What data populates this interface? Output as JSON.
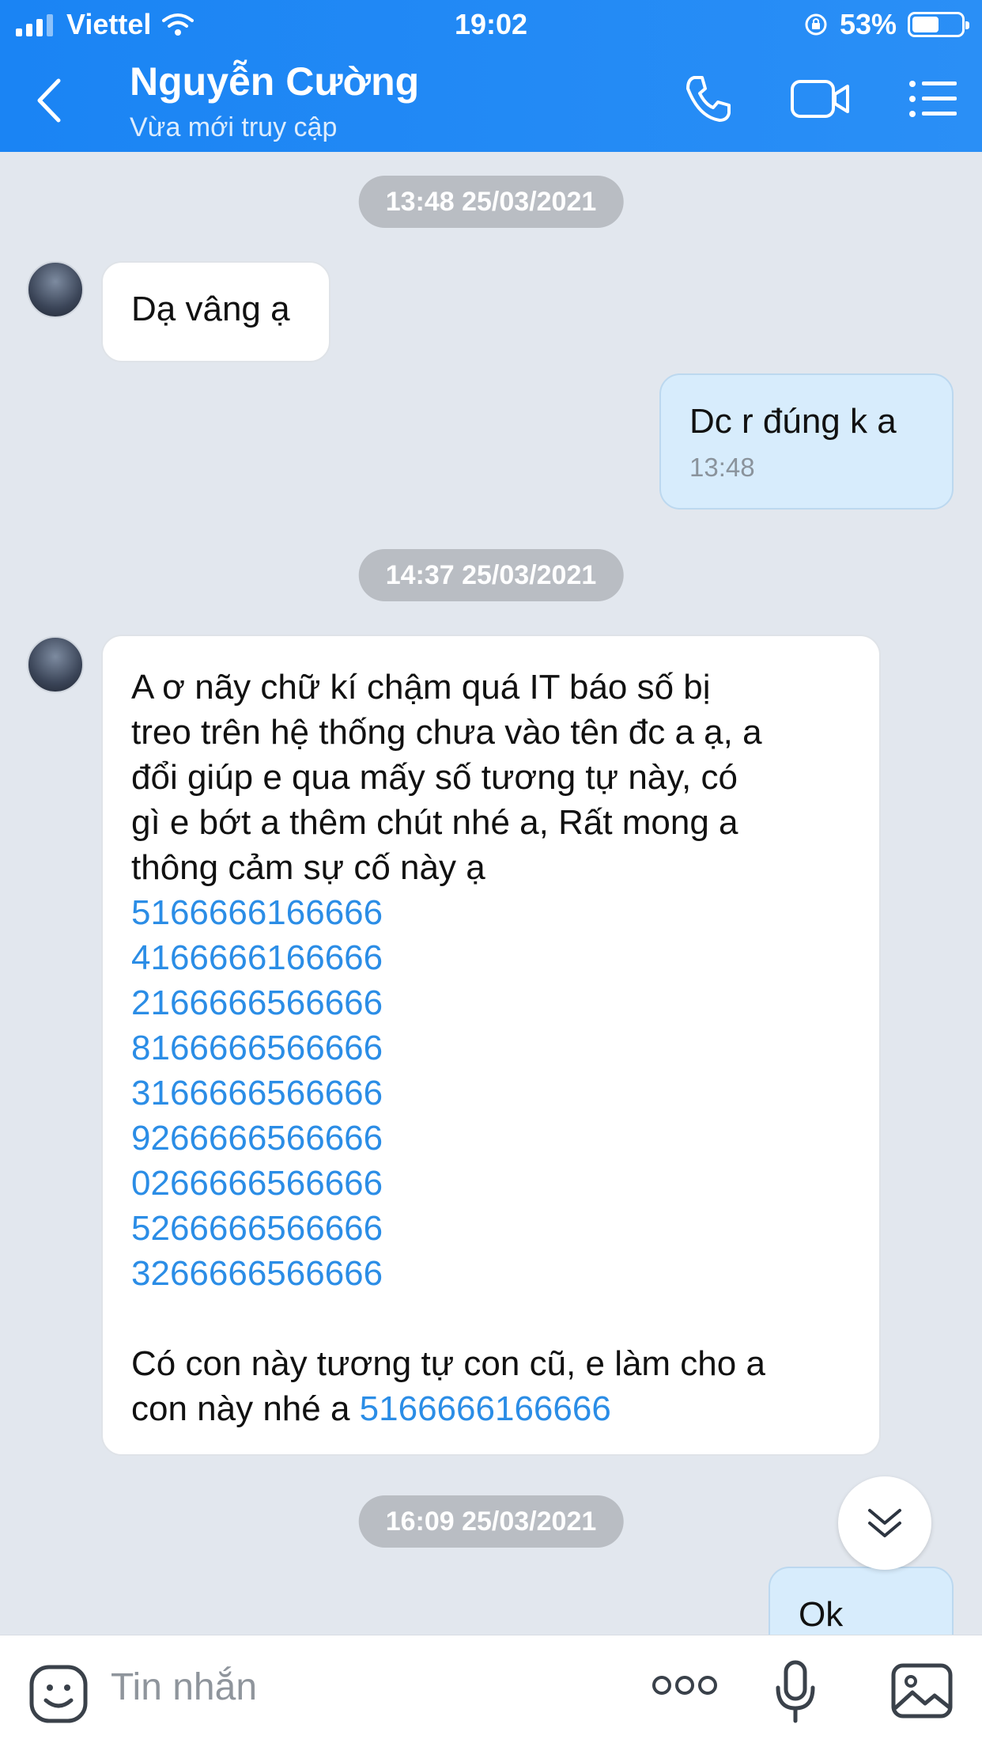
{
  "status_bar": {
    "carrier": "Viettel",
    "time": "19:02",
    "battery": "53%"
  },
  "header": {
    "title": "Nguyễn Cường",
    "subtitle": "Vừa mới truy cập"
  },
  "timestamps": [
    "13:48 25/03/2021",
    "14:37 25/03/2021",
    "16:09 25/03/2021"
  ],
  "messages": {
    "m1": {
      "text": "Dạ vâng ạ"
    },
    "m2": {
      "text": "Dc r đúng k a",
      "time": "13:48"
    },
    "m3": {
      "lines": [
        "A ơ nãy chữ kí chậm quá IT báo số bị",
        "treo trên hệ thống chưa vào tên đc a ạ, a",
        "đổi giúp e qua mấy số tương tự này, có",
        "gì e bớt a thêm chút nhé a, Rất mong a",
        "thông cảm sự cố này ạ"
      ],
      "numbers": [
        "5166666166666",
        "4166666166666",
        "2166666566666",
        "8166666566666",
        "3166666566666",
        "9266666566666",
        "0266666566666",
        "5266666566666",
        "3266666566666"
      ],
      "closing_line1": "Có con này tương tự con cũ, e làm cho a",
      "closing_line2": "con này nhé a ",
      "closing_number": "5166666166666"
    },
    "m4": {
      "text": "Ok"
    }
  },
  "composer": {
    "placeholder": "Tin nhắn"
  },
  "icons": {
    "back": "chevron-left-icon",
    "call": "phone-icon",
    "video": "video-camera-icon",
    "menu": "list-menu-icon",
    "sticker": "sticker-face-icon",
    "more": "more-dots-icon",
    "mic": "microphone-icon",
    "gallery": "image-gallery-icon",
    "scroll": "double-chevron-down-icon"
  },
  "colors": {
    "header": "#1a84f4",
    "link": "#2b8de6",
    "outgoing_bubble": "#d7ecfc",
    "background": "#e2e7ee"
  }
}
